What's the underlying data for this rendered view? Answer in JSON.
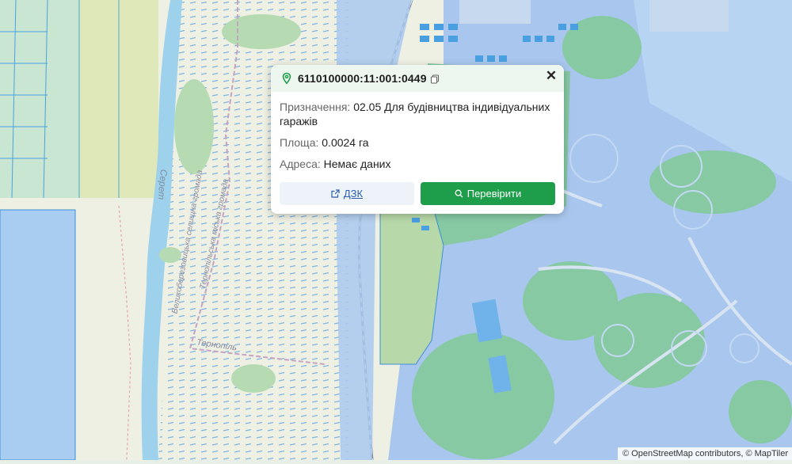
{
  "map": {
    "labels": {
      "river": "Серет",
      "city": "Тернопіль",
      "hromada_1": "Великоберезовицька селищна громада",
      "hromada_2": "Тернопільська міська громада"
    }
  },
  "popup": {
    "cadastral_number": "6110100000:11:001:0449",
    "purpose_label": "Призначення:",
    "purpose_value": "02.05 Для будівництва індивідуальних гаражів",
    "area_label": "Площа:",
    "area_value": "0.0024 га",
    "address_label": "Адреса:",
    "address_value": "Немає даних",
    "dzk_label": "ДЗК",
    "check_label": "Перевірити",
    "close_glyph": "✕"
  },
  "attribution": "© OpenStreetMap contributors, © MapTiler",
  "colors": {
    "accent_green": "#1e9e4a",
    "water": "#9dd0ec",
    "parcel_blue": "#a9c9f0",
    "forest": "#86c9a3"
  }
}
